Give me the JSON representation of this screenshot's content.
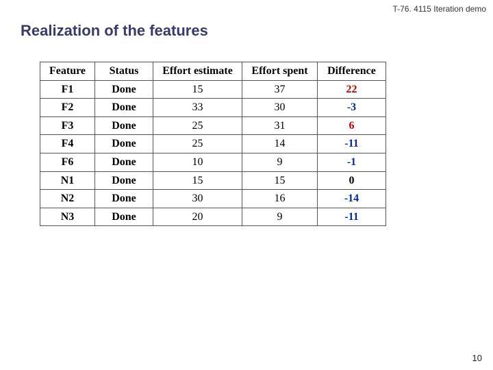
{
  "header": {
    "course_label": "T-76. 4115 Iteration demo",
    "slide_title": "Realization of the features"
  },
  "page": {
    "number": "10"
  },
  "chart_data": {
    "type": "table",
    "columns": [
      "Feature",
      "Status",
      "Effort estimate",
      "Effort spent",
      "Difference"
    ],
    "rows": [
      {
        "feature": "F1",
        "status": "Done",
        "estimate": 15,
        "spent": 37,
        "difference": 22
      },
      {
        "feature": "F2",
        "status": "Done",
        "estimate": 33,
        "spent": 30,
        "difference": -3
      },
      {
        "feature": "F3",
        "status": "Done",
        "estimate": 25,
        "spent": 31,
        "difference": 6
      },
      {
        "feature": "F4",
        "status": "Done",
        "estimate": 25,
        "spent": 14,
        "difference": -11
      },
      {
        "feature": "F6",
        "status": "Done",
        "estimate": 10,
        "spent": 9,
        "difference": -1
      },
      {
        "feature": "N1",
        "status": "Done",
        "estimate": 15,
        "spent": 15,
        "difference": 0
      },
      {
        "feature": "N2",
        "status": "Done",
        "estimate": 30,
        "spent": 16,
        "difference": -14
      },
      {
        "feature": "N3",
        "status": "Done",
        "estimate": 20,
        "spent": 9,
        "difference": -11
      }
    ]
  }
}
